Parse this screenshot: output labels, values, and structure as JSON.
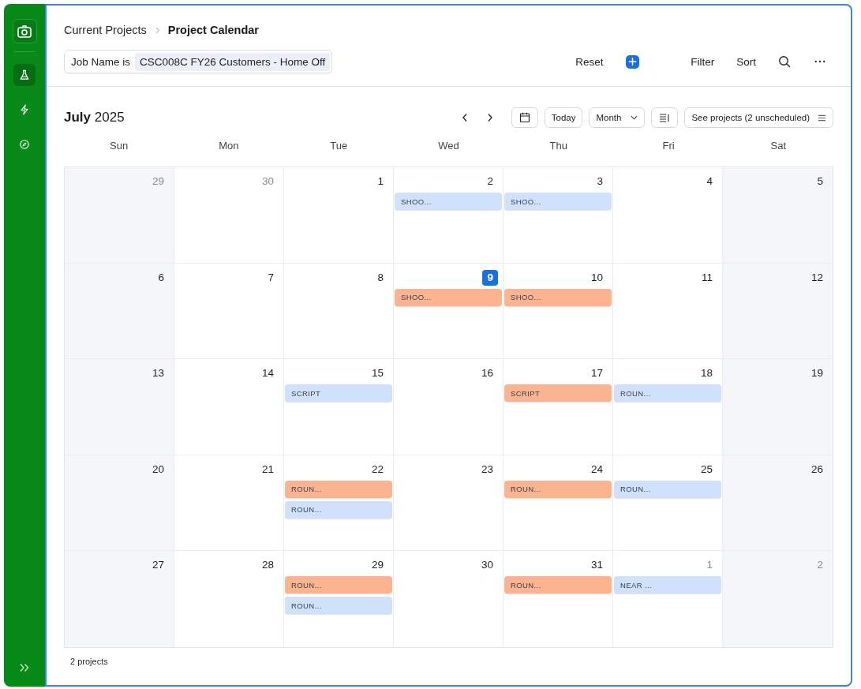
{
  "sidebar": {
    "items": [
      {
        "kind": "flask",
        "selected": true
      },
      {
        "kind": "bolt",
        "selected": false
      },
      {
        "kind": "compass",
        "selected": false
      }
    ]
  },
  "breadcrumb": [
    {
      "label": "Current Projects",
      "current": false
    },
    {
      "label": "Project Calendar",
      "current": true
    }
  ],
  "filter_chip": {
    "label": "Job Name is",
    "value": "CSC008C FY26 Customers - Home Off"
  },
  "toolbar": {
    "reset": "Reset",
    "filter": "Filter",
    "sort": "Sort"
  },
  "calendar": {
    "month": "July",
    "year": "2025",
    "today_button": "Today",
    "view": "Month",
    "see_projects": "See projects (2 unscheduled)",
    "weekdays": [
      "Sun",
      "Mon",
      "Tue",
      "Wed",
      "Thu",
      "Fri",
      "Sat"
    ],
    "weeks": [
      [
        {
          "day": "29",
          "in_month": false,
          "today": false
        },
        {
          "day": "30",
          "in_month": false,
          "today": false
        },
        {
          "day": "1",
          "in_month": true,
          "today": false
        },
        {
          "day": "2",
          "in_month": true,
          "today": false,
          "events": [
            {
              "label": "SHOO...",
              "color": "#d0e1fb"
            }
          ]
        },
        {
          "day": "3",
          "in_month": true,
          "today": false,
          "events": [
            {
              "label": "SHOO...",
              "color": "#d0e1fb"
            }
          ]
        },
        {
          "day": "4",
          "in_month": true,
          "today": false
        },
        {
          "day": "5",
          "in_month": true,
          "today": false
        }
      ],
      [
        {
          "day": "6",
          "in_month": true,
          "today": false
        },
        {
          "day": "7",
          "in_month": true,
          "today": false
        },
        {
          "day": "8",
          "in_month": true,
          "today": false
        },
        {
          "day": "9",
          "in_month": true,
          "today": true,
          "events": [
            {
              "label": "SHOO...",
              "color": "#fbb48f"
            }
          ]
        },
        {
          "day": "10",
          "in_month": true,
          "today": false,
          "events": [
            {
              "label": "SHOO...",
              "color": "#fbb48f"
            }
          ]
        },
        {
          "day": "11",
          "in_month": true,
          "today": false
        },
        {
          "day": "12",
          "in_month": true,
          "today": false
        }
      ],
      [
        {
          "day": "13",
          "in_month": true,
          "today": false
        },
        {
          "day": "14",
          "in_month": true,
          "today": false
        },
        {
          "day": "15",
          "in_month": true,
          "today": false,
          "events": [
            {
              "label": "SCRIPT",
              "color": "#d0e1fb"
            }
          ]
        },
        {
          "day": "16",
          "in_month": true,
          "today": false
        },
        {
          "day": "17",
          "in_month": true,
          "today": false,
          "events": [
            {
              "label": "SCRIPT",
              "color": "#fbb48f"
            }
          ]
        },
        {
          "day": "18",
          "in_month": true,
          "today": false,
          "events": [
            {
              "label": "ROUN...",
              "color": "#d0e1fb"
            }
          ]
        },
        {
          "day": "19",
          "in_month": true,
          "today": false
        }
      ],
      [
        {
          "day": "20",
          "in_month": true,
          "today": false
        },
        {
          "day": "21",
          "in_month": true,
          "today": false
        },
        {
          "day": "22",
          "in_month": true,
          "today": false,
          "events": [
            {
              "label": "ROUN...",
              "color": "#fbb48f"
            },
            {
              "label": "ROUN...",
              "color": "#d0e1fb"
            }
          ]
        },
        {
          "day": "23",
          "in_month": true,
          "today": false
        },
        {
          "day": "24",
          "in_month": true,
          "today": false,
          "events": [
            {
              "label": "ROUN...",
              "color": "#fbb48f"
            }
          ]
        },
        {
          "day": "25",
          "in_month": true,
          "today": false,
          "events": [
            {
              "label": "ROUN...",
              "color": "#d0e1fb"
            }
          ]
        },
        {
          "day": "26",
          "in_month": true,
          "today": false
        }
      ],
      [
        {
          "day": "27",
          "in_month": true,
          "today": false
        },
        {
          "day": "28",
          "in_month": true,
          "today": false
        },
        {
          "day": "29",
          "in_month": true,
          "today": false,
          "events": [
            {
              "label": "ROUN...",
              "color": "#fbb48f"
            },
            {
              "label": "ROUN...",
              "color": "#d0e1fb"
            }
          ]
        },
        {
          "day": "30",
          "in_month": true,
          "today": false
        },
        {
          "day": "31",
          "in_month": true,
          "today": false,
          "events": [
            {
              "label": "ROUN...",
              "color": "#fbb48f"
            }
          ]
        },
        {
          "day": "1",
          "in_month": false,
          "today": false,
          "events": [
            {
              "label": "NEAR ...",
              "color": "#d0e1fb"
            }
          ]
        },
        {
          "day": "2",
          "in_month": false,
          "today": false
        }
      ]
    ]
  },
  "footer": "2 projects"
}
